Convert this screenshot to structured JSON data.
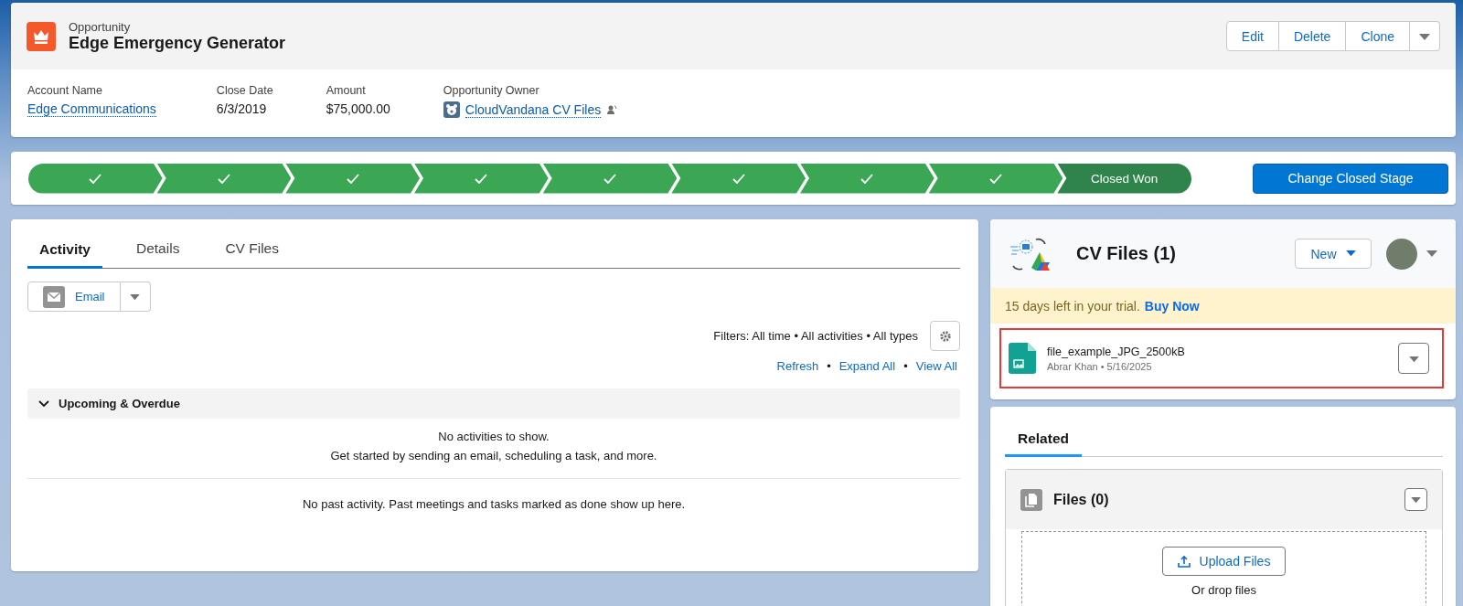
{
  "record": {
    "type": "Opportunity",
    "title": "Edge Emergency Generator",
    "actions": [
      "Edit",
      "Delete",
      "Clone"
    ],
    "fields": [
      {
        "label": "Account Name",
        "value": "Edge Communications",
        "kind": "link"
      },
      {
        "label": "Close Date",
        "value": "6/3/2019",
        "kind": "text"
      },
      {
        "label": "Amount",
        "value": "$75,000.00",
        "kind": "text"
      },
      {
        "label": "Opportunity Owner",
        "value": "CloudVandana CV Files",
        "kind": "user"
      }
    ]
  },
  "path": {
    "stages": [
      {
        "kind": "complete"
      },
      {
        "kind": "complete"
      },
      {
        "kind": "complete"
      },
      {
        "kind": "complete"
      },
      {
        "kind": "complete"
      },
      {
        "kind": "complete"
      },
      {
        "kind": "complete"
      },
      {
        "kind": "complete"
      },
      {
        "kind": "current",
        "label": "Closed Won"
      }
    ],
    "button": "Change Closed Stage"
  },
  "tabs": [
    {
      "label": "Activity",
      "selected": true
    },
    {
      "label": "Details",
      "selected": false
    },
    {
      "label": "CV Files",
      "selected": false
    }
  ],
  "activity": {
    "email_button": "Email",
    "filters": "Filters: All time • All activities • All types",
    "links": [
      "Refresh",
      "Expand All",
      "View All"
    ],
    "link_separator": "•",
    "section": {
      "title": "Upcoming & Overdue",
      "expanded": true,
      "empty": [
        "No activities to show.",
        "Get started by sending an email, scheduling a task, and more."
      ]
    },
    "past": "No past activity. Past meetings and tasks marked as done show up here."
  },
  "cv_files": {
    "title": "CV Files (1)",
    "new_button": "New",
    "trial": {
      "text": "15 days left in your trial.",
      "link": "Buy Now"
    },
    "files": [
      {
        "name": "file_example_JPG_2500kB",
        "meta": "Abrar Khan • 5/16/2025",
        "highlighted": true
      }
    ]
  },
  "related": {
    "tab": "Related",
    "files": {
      "title": "Files (0)",
      "upload": "Upload Files",
      "drop": "Or drop files"
    }
  }
}
